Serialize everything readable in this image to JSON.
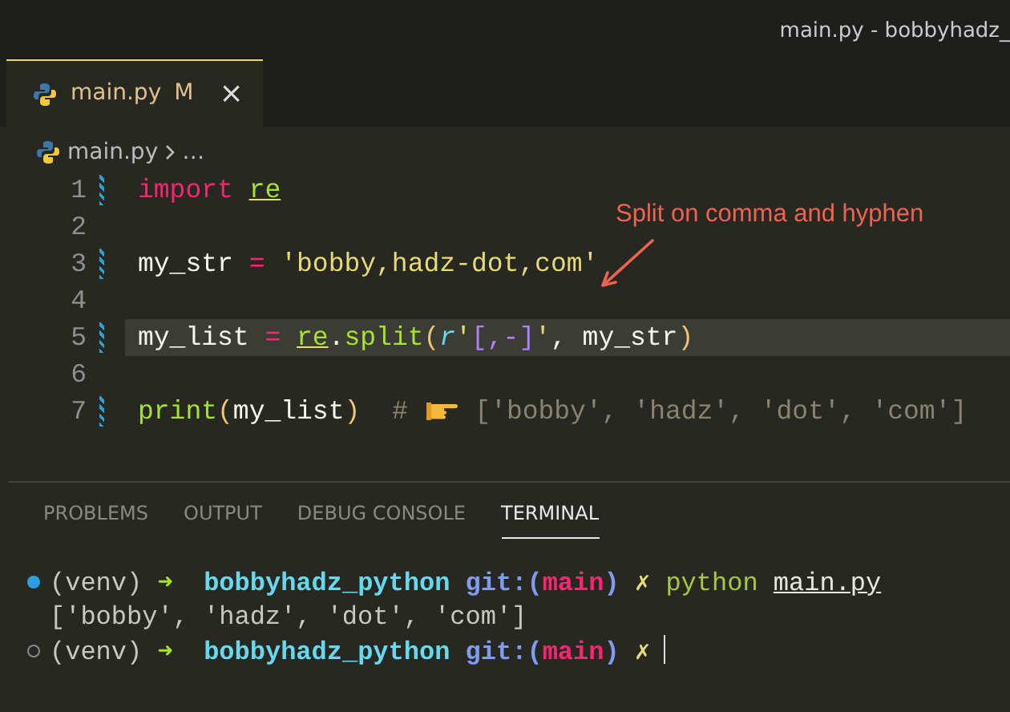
{
  "window": {
    "title": "main.py - bobbyhadz_"
  },
  "tabs": [
    {
      "label": "main.py",
      "badge": "M",
      "close": "×",
      "selected": true
    }
  ],
  "breadcrumb": [
    "main.py",
    "…"
  ],
  "editor": {
    "lines": [
      {
        "number": "1",
        "modified": true,
        "current": false,
        "tokens": [
          {
            "kind": "keyword",
            "text": "import "
          },
          {
            "kind": "module",
            "text": "re"
          }
        ]
      },
      {
        "number": "2",
        "modified": false,
        "current": false
      },
      {
        "number": "3",
        "modified": true,
        "current": false,
        "tokens": [
          {
            "kind": "name",
            "text": "my_str "
          },
          {
            "kind": "op",
            "text": "= "
          },
          {
            "kind": "string",
            "text": "'bobby,hadz-dot,com'"
          }
        ]
      },
      {
        "number": "4",
        "modified": false,
        "current": false
      },
      {
        "number": "5",
        "modified": true,
        "current": true,
        "tokens": [
          {
            "kind": "name",
            "text": "my_list "
          },
          {
            "kind": "op",
            "text": "= "
          },
          {
            "kind": "module",
            "text": "re"
          },
          {
            "kind": "name",
            "text": "."
          },
          {
            "kind": "func",
            "text": "split"
          },
          {
            "kind": "paren",
            "text": "("
          },
          {
            "kind": "prefix",
            "text": "r"
          },
          {
            "kind": "string",
            "text": "'"
          },
          {
            "kind": "regex",
            "text": "[,-]"
          },
          {
            "kind": "string",
            "text": "'"
          },
          {
            "kind": "name",
            "text": ", my_str"
          },
          {
            "kind": "paren",
            "text": ")"
          }
        ]
      },
      {
        "number": "6",
        "modified": false,
        "current": false
      },
      {
        "number": "7",
        "modified": true,
        "current": false,
        "tokens": [
          {
            "kind": "func",
            "text": "print"
          },
          {
            "kind": "paren",
            "text": "("
          },
          {
            "kind": "name",
            "text": "my_list"
          },
          {
            "kind": "paren",
            "text": ")"
          },
          {
            "kind": "comment",
            "text": "  # "
          },
          {
            "kind": "pointer"
          },
          {
            "kind": "comment",
            "text": " ['bobby', 'hadz', 'dot', 'com']"
          }
        ]
      }
    ]
  },
  "annotation": {
    "text": "Split on comma and hyphen"
  },
  "panel_tabs": [
    {
      "label": "PROBLEMS",
      "selected": false
    },
    {
      "label": "OUTPUT",
      "selected": false
    },
    {
      "label": "DEBUG CONSOLE",
      "selected": false
    },
    {
      "label": "TERMINAL",
      "selected": true
    }
  ],
  "terminal": [
    {
      "kind": "prompt",
      "dot_filled": true,
      "venv": "(venv)",
      "arrow": "➜",
      "dir": "bobbyhadz_python",
      "git_open": "git:(",
      "branch": "main",
      "git_close": ")",
      "dirty": "✗",
      "command": "python",
      "argument": "main.py",
      "cursor": false
    },
    {
      "kind": "output",
      "text": "['bobby', 'hadz', 'dot', 'com']"
    },
    {
      "kind": "prompt",
      "dot_filled": false,
      "venv": "(venv)",
      "arrow": "➜",
      "dir": "bobbyhadz_python",
      "git_open": "git:(",
      "branch": "main",
      "git_close": ")",
      "dirty": "✗",
      "cursor": true
    }
  ]
}
